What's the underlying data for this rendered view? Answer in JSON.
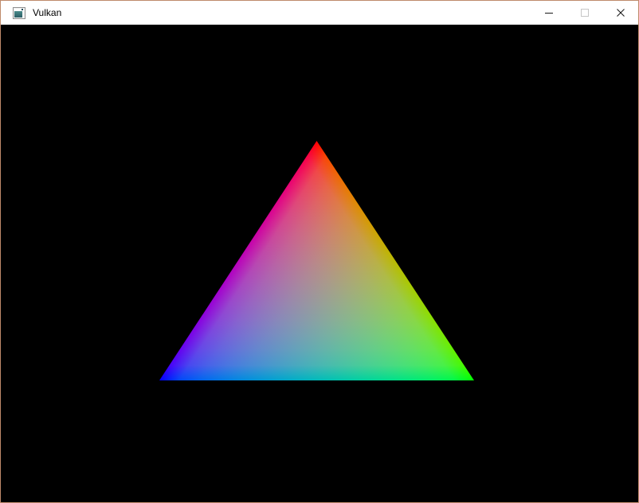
{
  "window": {
    "title": "Vulkan",
    "icon": "default-window-icon",
    "controls": {
      "minimize": {
        "name": "minimize",
        "enabled": true
      },
      "maximize": {
        "name": "maximize",
        "enabled": false
      },
      "close": {
        "name": "close",
        "enabled": true
      }
    }
  },
  "colors": {
    "window_border": "#bf8a6b",
    "titlebar_bg": "#ffffff",
    "titlebar_text": "#000000",
    "caption_glyph": "#1a1a1a",
    "maximize_disabled": "#c6c6c6",
    "client_bg": "#000000"
  },
  "viewport": {
    "background": "#000000",
    "triangle": {
      "vertices": [
        {
          "corner": "top",
          "color": "#ff0000"
        },
        {
          "corner": "bottom-left",
          "color": "#0000ff"
        },
        {
          "corner": "bottom-right",
          "color": "#00ff00"
        }
      ]
    }
  }
}
